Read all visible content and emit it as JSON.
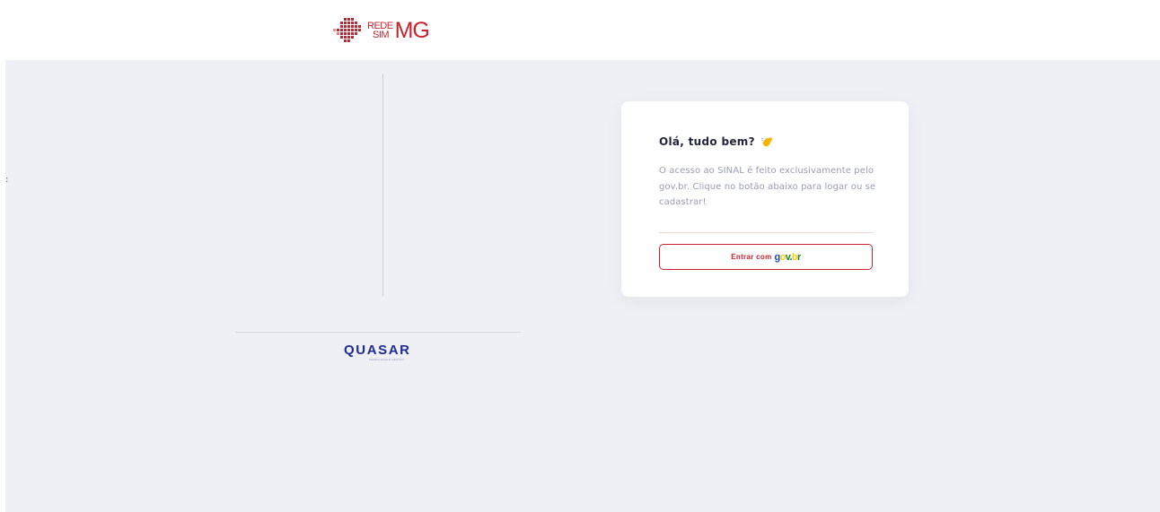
{
  "header": {
    "logo": {
      "line1": "REDE",
      "line2": "SIM",
      "suffix": "MG",
      "brand_color": "#c8222d"
    }
  },
  "left_panel": {
    "edge_glyph": ":",
    "footer_logo": {
      "name": "QUASAR",
      "tagline": "TECNOLOGIA E GESTÃO",
      "color": "#1d2c91"
    }
  },
  "card": {
    "title": "Olá, tudo bem?",
    "wave_icon": "waving-hand-icon",
    "text": "O acesso ao SINAL é feito exclusivamente pelo gov.br. Clique no botão abaixo para logar ou se cadastrar!",
    "button": {
      "label": "Entrar com",
      "logo_text": "gov.br",
      "accent": "#c8222d"
    }
  },
  "colors": {
    "background": "#eff0f5",
    "card": "#ffffff",
    "govbr_blue": "#1351b4",
    "govbr_yellow": "#ffcd07",
    "govbr_green": "#168821"
  }
}
